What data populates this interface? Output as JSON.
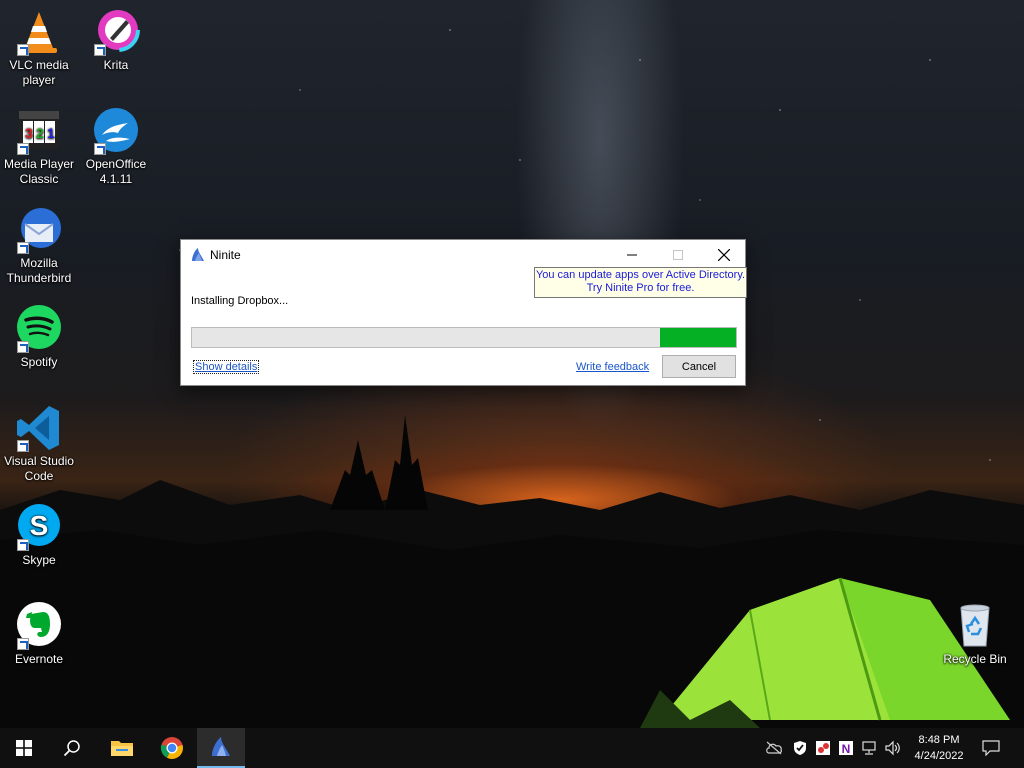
{
  "desktop": {
    "icons": [
      {
        "label": "VLC media player",
        "icon": "vlc-icon"
      },
      {
        "label": "Krita",
        "icon": "krita-icon"
      },
      {
        "label": "Media Player Classic",
        "icon": "mpc-icon"
      },
      {
        "label": "OpenOffice 4.1.11",
        "icon": "openoffice-icon"
      },
      {
        "label": "Mozilla Thunderbird",
        "icon": "thunderbird-icon"
      },
      {
        "label": "Spotify",
        "icon": "spotify-icon"
      },
      {
        "label": "Visual Studio Code",
        "icon": "vscode-icon"
      },
      {
        "label": "Skype",
        "icon": "skype-icon"
      },
      {
        "label": "Evernote",
        "icon": "evernote-icon"
      },
      {
        "label": "Recycle Bin",
        "icon": "recycle-bin-icon"
      }
    ]
  },
  "dialog": {
    "title": "Ninite",
    "promo_line1": "You can update apps over Active Directory.",
    "promo_line2": "Try Ninite Pro for free.",
    "status": "Installing Dropbox...",
    "progress_fraction": 0.14,
    "show_details": "Show details",
    "write_feedback": "Write feedback",
    "cancel": "Cancel"
  },
  "taskbar": {
    "time": "8:48 PM",
    "date": "4/24/2022",
    "pinned": [
      "start-icon",
      "search-icon",
      "file-explorer-icon",
      "chrome-icon",
      "ninite-icon"
    ]
  },
  "colors": {
    "progress": "#06b025",
    "link": "#1a56c7",
    "promo_text": "#1a1adb"
  }
}
